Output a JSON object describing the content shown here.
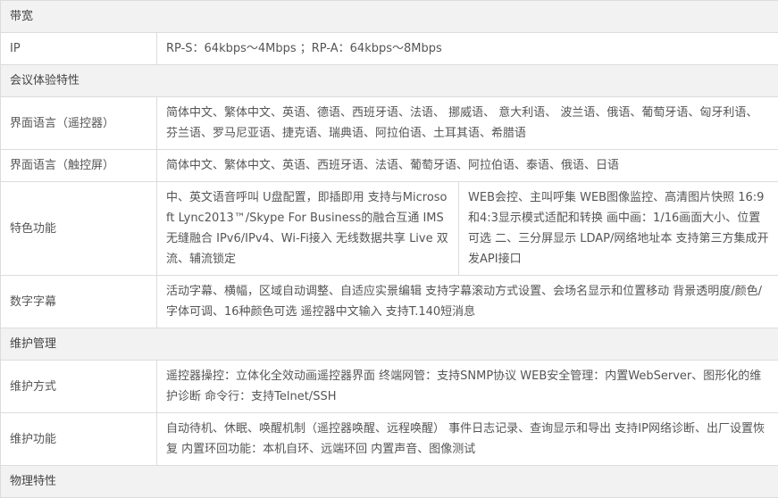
{
  "sections": {
    "bandwidth": "带宽",
    "meeting": "会议体验特性",
    "maintenance": "维护管理",
    "physical": "物理特性"
  },
  "rows": {
    "ip": {
      "label": "IP",
      "value": "RP-S：64kbps～4Mbps ；RP-A：64kbps～8Mbps"
    },
    "ui_remote": {
      "label": "界面语言（遥控器）",
      "value": "简体中文、繁体中文、英语、德语、西班牙语、法语、 挪威语、 意大利语、 波兰语、俄语、葡萄牙语、匈牙利语、芬兰语、罗马尼亚语、捷克语、瑞典语、阿拉伯语、土耳其语、希腊语"
    },
    "ui_touch": {
      "label": "界面语言（触控屏）",
      "value": "简体中文、繁体中文、英语、西班牙语、法语、葡萄牙语、阿拉伯语、泰语、俄语、日语"
    },
    "features": {
      "label": "特色功能",
      "left": "中、英文语音呼叫 U盘配置，即插即用 支持与Microsoft Lync2013™/Skype For Business的融合互通 IMS无缝融合 IPv6/IPv4、Wi-Fi接入 无线数据共享 Live 双流、辅流锁定",
      "right": "WEB会控、主叫呼集 WEB图像监控、高清图片快照 16:9和4:3显示模式适配和转换 画中画：1/16画面大小、位置可选 二、三分屏显示 LDAP/网络地址本 支持第三方集成开发API接口"
    },
    "subtitle": {
      "label": "数字字幕",
      "value": "活动字幕、横幅，区域自动调整、自适应实景编辑 支持字幕滚动方式设置、会场名显示和位置移动 背景透明度/颜色/字体可调、16种颜色可选 遥控器中文输入 支持T.140短消息"
    },
    "maint_method": {
      "label": "维护方式",
      "value": "遥控器操控：立体化全效动画遥控器界面 终端网管：支持SNMP协议 WEB安全管理：内置WebServer、图形化的维护诊断 命令行：支持Telnet/SSH"
    },
    "maint_func": {
      "label": "维护功能",
      "value": "自动待机、休眠、唤醒机制（遥控器唤醒、远程唤醒） 事件日志记录、查询显示和导出 支持IP网络诊断、出厂设置恢复 内置环回功能：本机自环、远端环回 内置声音、图像测试"
    }
  }
}
